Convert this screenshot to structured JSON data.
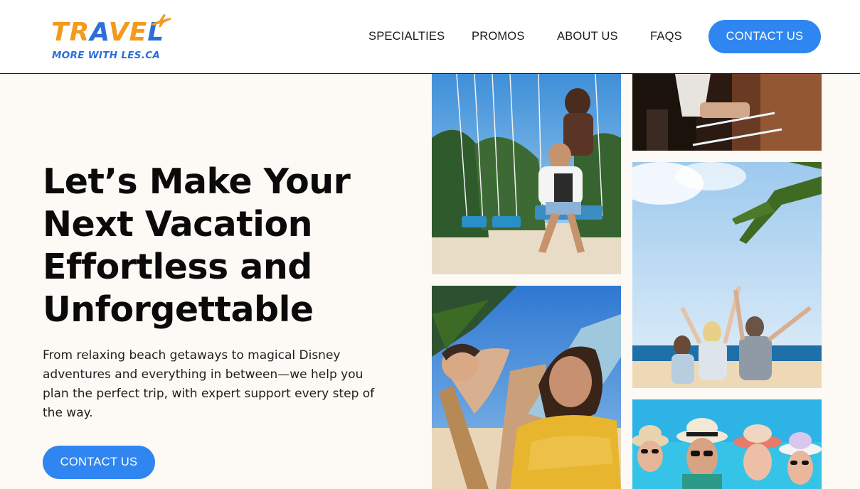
{
  "brand": {
    "logo_word": "TRAVEL",
    "logo_tagline": "MORE WITH LES.CA",
    "colors": {
      "orange": "#f39a1d",
      "blue": "#2b6fd8"
    }
  },
  "nav": {
    "items": [
      {
        "label": "SPECIALTIES"
      },
      {
        "label": "PROMOS"
      },
      {
        "label": "ABOUT US"
      },
      {
        "label": "FAQS"
      }
    ],
    "cta_label": "CONTACT US"
  },
  "hero": {
    "title_lines": [
      "Let’s Make Your",
      "Next Vacation",
      "Effortless and",
      "Unforgettable"
    ],
    "description": "From relaxing beach getaways to magical Disney adventures and everything in between—we help you plan the perfect trip, with expert support every step of the way.",
    "cta_label": "CONTACT US"
  },
  "gallery": {
    "photos": [
      {
        "name": "beach-swing-couple-photo"
      },
      {
        "name": "bar-interior-photo"
      },
      {
        "name": "beach-hammock-couple-photo"
      },
      {
        "name": "family-beach-cheering-photo"
      },
      {
        "name": "friends-sun-hats-photo"
      }
    ]
  },
  "colors": {
    "accent": "#2f86f0",
    "background": "#fdf9f4"
  }
}
